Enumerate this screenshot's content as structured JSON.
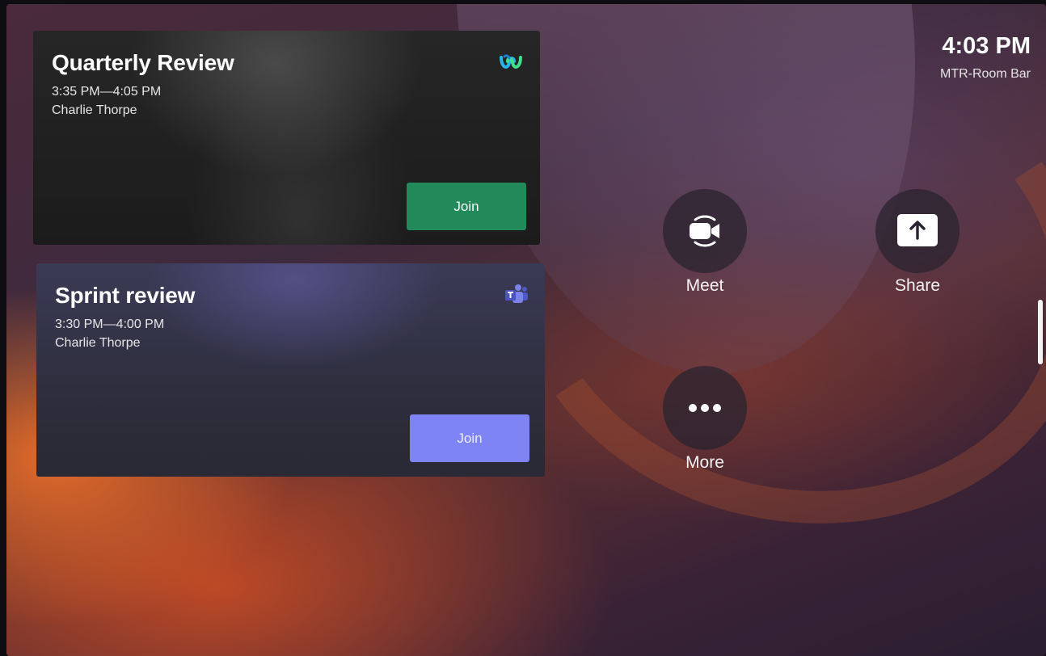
{
  "clock": {
    "time": "4:03 PM",
    "room_name": "MTR-Room Bar"
  },
  "meetings": [
    {
      "title": "Quarterly Review",
      "time": "3:35 PM—4:05 PM",
      "organizer": "Charlie Thorpe",
      "platform_icon": "webex-icon",
      "join_label": "Join",
      "join_color": "#22895a"
    },
    {
      "title": "Sprint review",
      "time": "3:30 PM—4:00 PM",
      "organizer": "Charlie Thorpe",
      "platform_icon": "teams-icon",
      "join_label": "Join",
      "join_color": "#7f84f5"
    }
  ],
  "actions": {
    "meet": {
      "label": "Meet",
      "icon": "video-camera-icon"
    },
    "share": {
      "label": "Share",
      "icon": "share-upload-icon"
    },
    "more": {
      "label": "More",
      "icon": "more-dots-icon"
    }
  }
}
